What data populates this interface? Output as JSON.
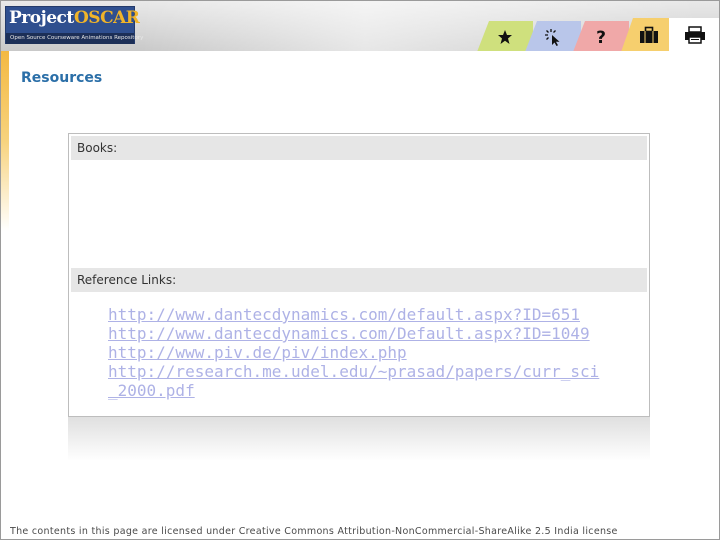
{
  "header": {
    "logo": {
      "word1": "Project",
      "word2": "OSCAR",
      "tagline": "Open Source Courseware Animations Repository"
    },
    "tabs": [
      {
        "name": "star",
        "icon": "star-icon",
        "color": "#cfe07d"
      },
      {
        "name": "pointer",
        "icon": "cursor-click-icon",
        "color": "#b9c6ea"
      },
      {
        "name": "help",
        "icon": "question-icon",
        "color": "#f0a8a8"
      },
      {
        "name": "tools",
        "icon": "briefcase-icon",
        "color": "#f6cf6e"
      },
      {
        "name": "print",
        "icon": "printer-icon",
        "color": "#ffffff"
      }
    ]
  },
  "page": {
    "title": "Resources"
  },
  "sections": {
    "books": {
      "heading": "Books:"
    },
    "references": {
      "heading": "Reference Links:",
      "links": [
        "http://www.dantecdynamics.com/default.aspx?ID=651",
        "http://www.dantecdynamics.com/Default.aspx?ID=1049",
        "http://www.piv.de/piv/index.php",
        "http://research.me.udel.edu/~prasad/papers/curr_sci_2000.pdf"
      ]
    }
  },
  "footer": {
    "text": "The contents in this page are licensed under Creative Commons Attribution-NonCommercial-ShareAlike 2.5 India license"
  },
  "colors": {
    "title": "#2b6fa8",
    "link": "#aeb2e6",
    "accent_orange": "#f4b942",
    "logo_blue": "#2f4f8f"
  }
}
